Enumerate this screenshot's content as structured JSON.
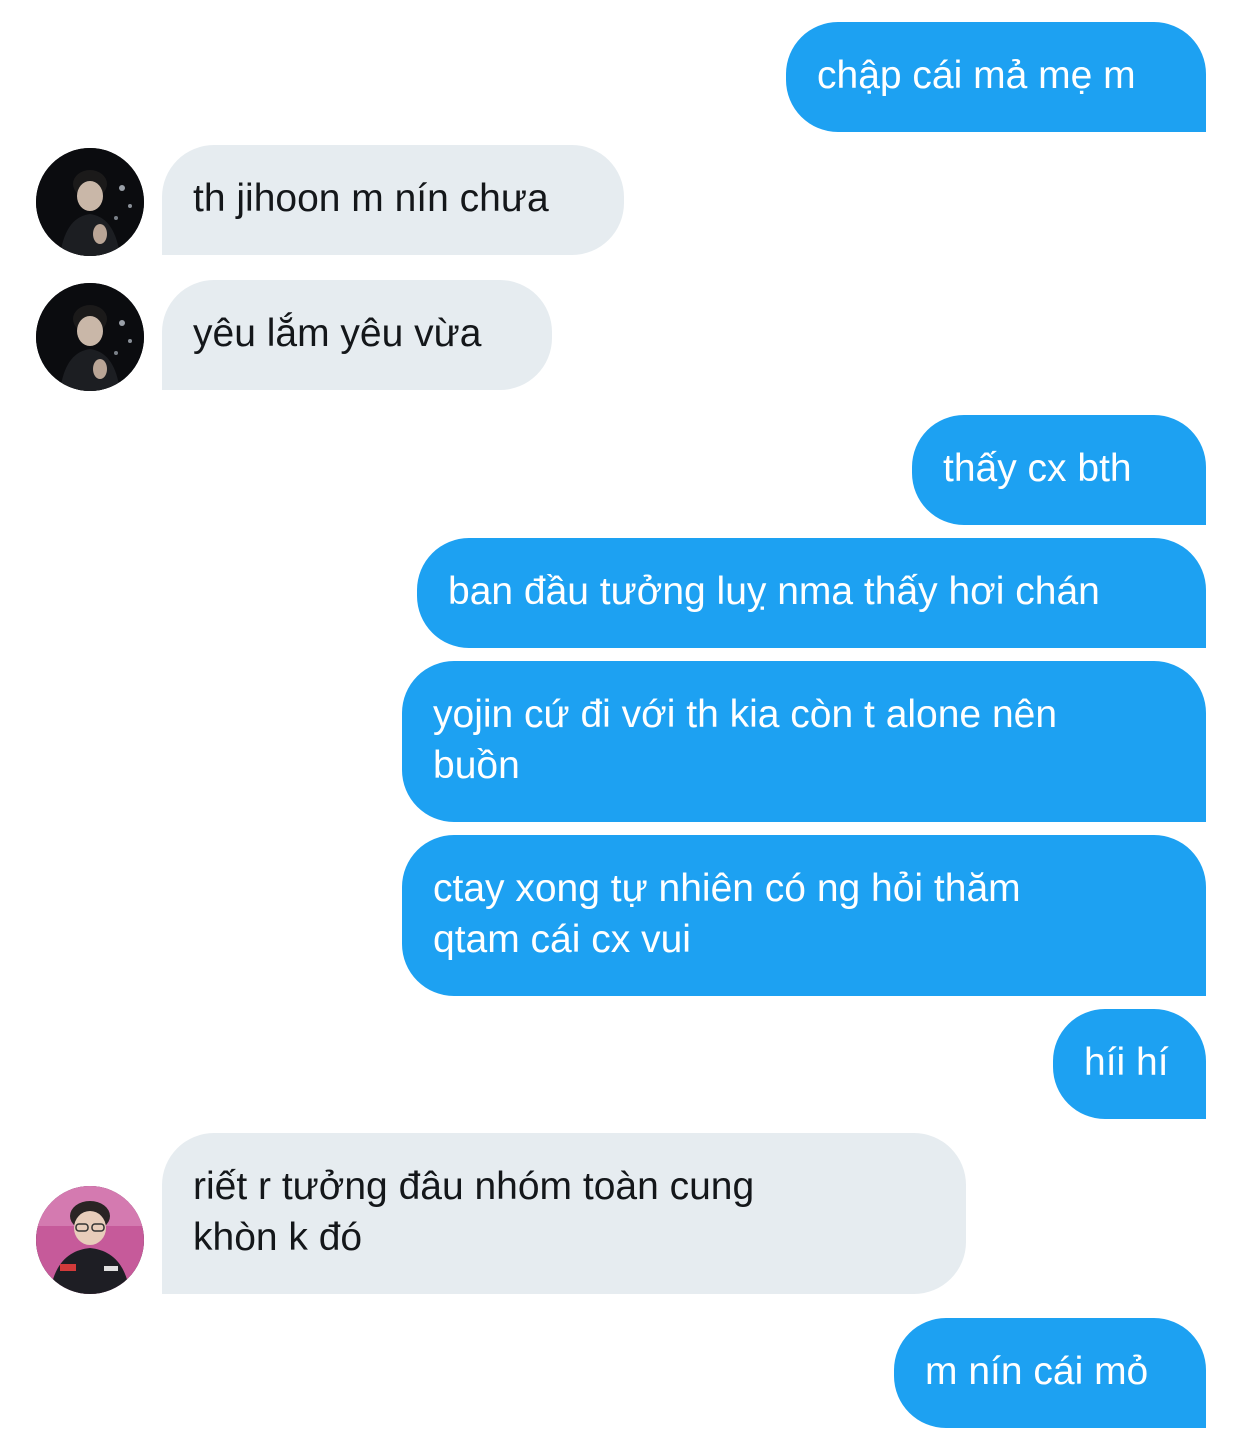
{
  "colors": {
    "sent_bubble": "#1da1f2",
    "received_bubble": "#e6ecf0",
    "sent_text": "#ffffff",
    "received_text": "#14171a"
  },
  "messages": [
    {
      "sender": "me",
      "text": "chập cái mả mẹ m"
    },
    {
      "sender": "other",
      "avatar": "user-avatar-1",
      "text": "th jihoon m nín chưa"
    },
    {
      "sender": "other",
      "avatar": "user-avatar-1",
      "text": "yêu lắm yêu vừa"
    },
    {
      "sender": "me",
      "text": "thấy cx bth"
    },
    {
      "sender": "me",
      "text": "ban đầu tưởng luỵ nma thấy hơi chán"
    },
    {
      "sender": "me",
      "text": "yojin cứ đi với th kia còn t alone nên\nbuồn"
    },
    {
      "sender": "me",
      "text": "ctay xong tự nhiên có ng hỏi thăm\nqtam cái cx vui"
    },
    {
      "sender": "me",
      "text": "híi hí"
    },
    {
      "sender": "other",
      "avatar": "user-avatar-2",
      "text": "riết r tưởng đâu nhóm toàn cung\nkhòn k đó"
    },
    {
      "sender": "me",
      "text": "m nín cái mỏ"
    }
  ]
}
